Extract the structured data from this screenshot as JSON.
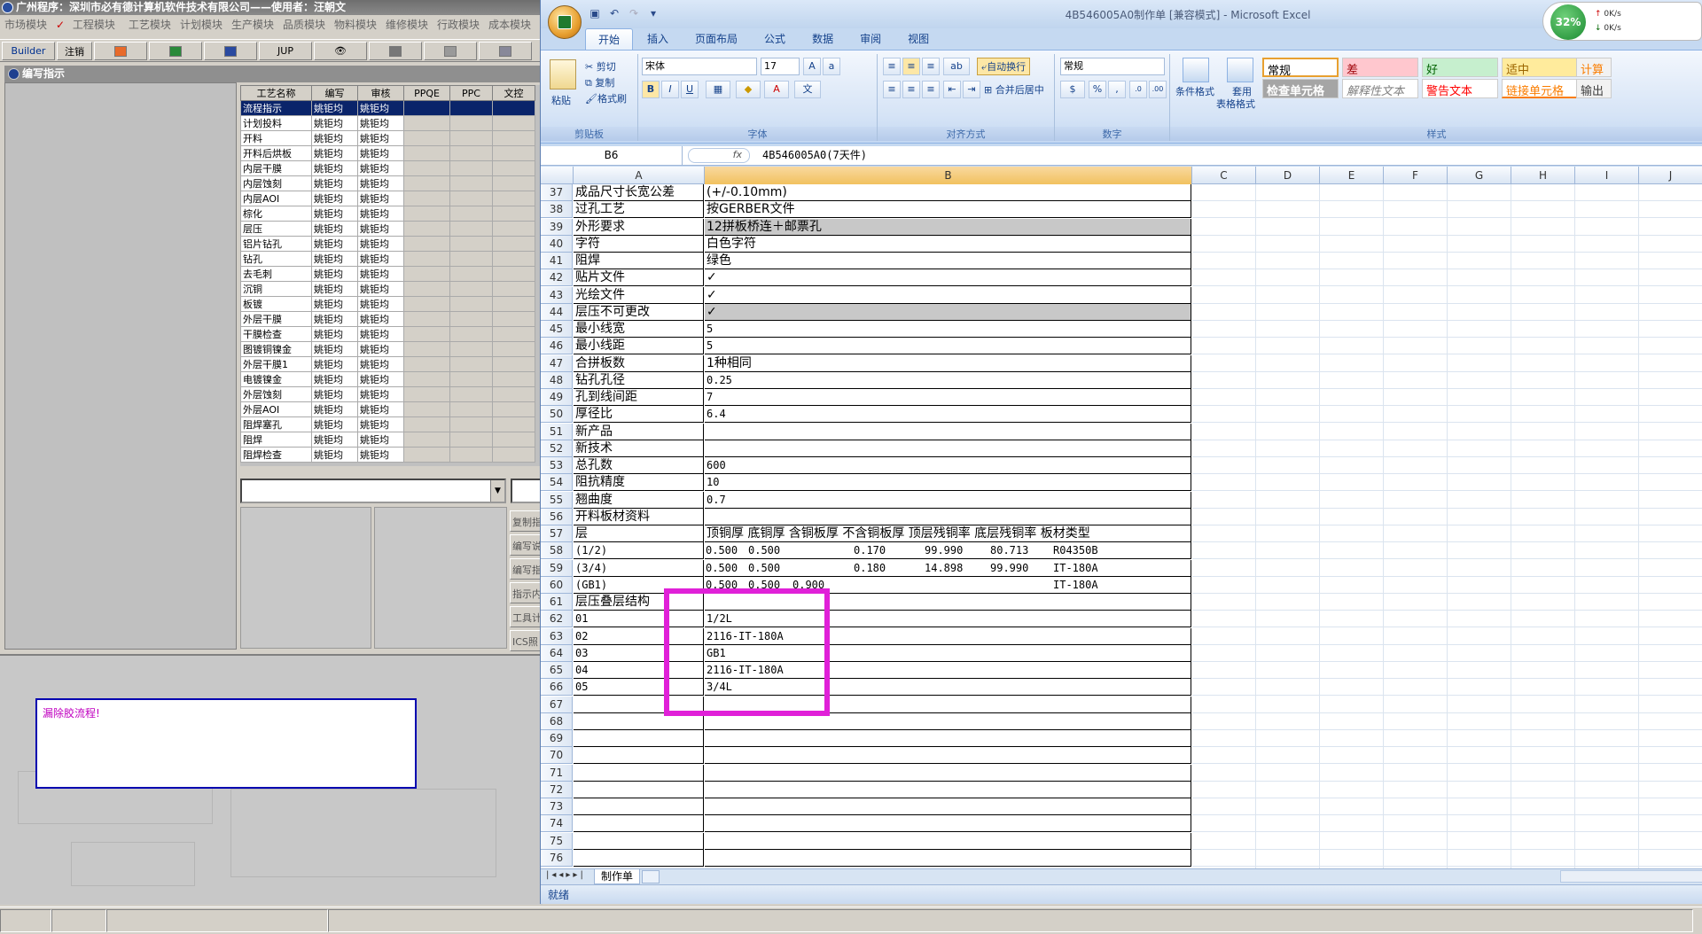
{
  "legacy_app": {
    "title": "广州程序：深圳市必有德计算机软件技术有限公司——使用者：汪朝文",
    "menu": [
      "市场模块",
      "工程模块",
      "工艺模块",
      "计划模块",
      "生产模块",
      "品质模块",
      "物料模块",
      "维修模块",
      "行政模块",
      "成本模块"
    ],
    "toolbar": {
      "builder": "Builder",
      "logout": "注销",
      "jup": "JUP"
    },
    "panel_title": "编写指示",
    "grid_headers": [
      "工艺名称",
      "编写",
      "审核",
      "PPQE",
      "PPC",
      "文控"
    ],
    "grid_rows": [
      [
        "流程指示",
        "姚钜均",
        "姚钜均"
      ],
      [
        "计划投料",
        "姚钜均",
        "姚钜均"
      ],
      [
        "开料",
        "姚钜均",
        "姚钜均"
      ],
      [
        "开料后烘板",
        "姚钜均",
        "姚钜均"
      ],
      [
        "内层干膜",
        "姚钜均",
        "姚钜均"
      ],
      [
        "内层蚀刻",
        "姚钜均",
        "姚钜均"
      ],
      [
        "内层AOI",
        "姚钜均",
        "姚钜均"
      ],
      [
        "棕化",
        "姚钜均",
        "姚钜均"
      ],
      [
        "层压",
        "姚钜均",
        "姚钜均"
      ],
      [
        "铝片钻孔",
        "姚钜均",
        "姚钜均"
      ],
      [
        "钻孔",
        "姚钜均",
        "姚钜均"
      ],
      [
        "去毛刺",
        "姚钜均",
        "姚钜均"
      ],
      [
        "沉铜",
        "姚钜均",
        "姚钜均"
      ],
      [
        "板镀",
        "姚钜均",
        "姚钜均"
      ],
      [
        "外层干膜",
        "姚钜均",
        "姚钜均"
      ],
      [
        "干膜检查",
        "姚钜均",
        "姚钜均"
      ],
      [
        "图镀铜镍金",
        "姚钜均",
        "姚钜均"
      ],
      [
        "外层干膜1",
        "姚钜均",
        "姚钜均"
      ],
      [
        "电镀镍金",
        "姚钜均",
        "姚钜均"
      ],
      [
        "外层蚀刻",
        "姚钜均",
        "姚钜均"
      ],
      [
        "外层AOI",
        "姚钜均",
        "姚钜均"
      ],
      [
        "阻焊塞孔",
        "姚钜均",
        "姚钜均"
      ],
      [
        "阻焊",
        "姚钜均",
        "姚钜均"
      ],
      [
        "阻焊检查",
        "姚钜均",
        "姚钜均"
      ]
    ],
    "side_buttons": [
      "复制指",
      "编写说",
      "编写指",
      "指示内",
      "工具计",
      "ICS照"
    ],
    "message": "漏除胶流程!"
  },
  "excel": {
    "title": "4B546005A0制作单  [兼容模式] - Microsoft Excel",
    "net": {
      "percent": "32%",
      "up": "0K/s",
      "down": "0K/s"
    },
    "tabs": [
      "开始",
      "插入",
      "页面布局",
      "公式",
      "数据",
      "审阅",
      "视图"
    ],
    "ribbon": {
      "paste": "粘贴",
      "cut": "剪切",
      "copy": "复制",
      "format_painter": "格式刷",
      "font": "宋体",
      "font_size": "17",
      "wrap": "自动换行",
      "merge": "合并后居中",
      "number_format": "常规",
      "cond_format": "条件格式",
      "table_format_1": "套用",
      "table_format_2": "表格格式",
      "groups": [
        "剪贴板",
        "字体",
        "对齐方式",
        "数字",
        "样式"
      ],
      "styles": [
        {
          "label": "常规",
          "bg": "#ffffff",
          "fg": "#000000"
        },
        {
          "label": "差",
          "bg": "#ffc7ce",
          "fg": "#9c0006"
        },
        {
          "label": "好",
          "bg": "#c6efce",
          "fg": "#006100"
        },
        {
          "label": "适中",
          "bg": "#ffeb9c",
          "fg": "#9c6500"
        },
        {
          "label": "计算",
          "bg": "#f2f2f2",
          "fg": "#fa7d00"
        },
        {
          "label": "检查单元格",
          "bg": "#a5a5a5",
          "fg": "#ffffff"
        },
        {
          "label": "解释性文本",
          "bg": "#ffffff",
          "fg": "#7f7f7f"
        },
        {
          "label": "警告文本",
          "bg": "#ffffff",
          "fg": "#ff0000"
        },
        {
          "label": "链接单元格",
          "bg": "#ffffff",
          "fg": "#fa7d00"
        },
        {
          "label": "输出",
          "bg": "#f2f2f2",
          "fg": "#3f3f3f"
        }
      ]
    },
    "name_box": "B6",
    "fx": "fx",
    "formula": "4B546005A0(7天件)",
    "columns": [
      "A",
      "B",
      "C",
      "D",
      "E",
      "F",
      "G",
      "H",
      "I",
      "J"
    ],
    "rows": [
      {
        "n": "37",
        "a": "成品尺寸长宽公差",
        "b": "(+/-0.10mm)"
      },
      {
        "n": "38",
        "a": "过孔工艺",
        "b": "按GERBER文件"
      },
      {
        "n": "39",
        "a": "外形要求",
        "b": "12拼板桥连＋邮票孔",
        "gray": true
      },
      {
        "n": "40",
        "a": "字符",
        "b": "白色字符"
      },
      {
        "n": "41",
        "a": "阻焊",
        "b": "绿色"
      },
      {
        "n": "42",
        "a": "贴片文件",
        "b": "✓"
      },
      {
        "n": "43",
        "a": "光绘文件",
        "b": "✓"
      },
      {
        "n": "44",
        "a": "层压不可更改",
        "b": "✓",
        "gray": true
      },
      {
        "n": "45",
        "a": "最小线宽",
        "b": "5"
      },
      {
        "n": "46",
        "a": "最小线距",
        "b": "5"
      },
      {
        "n": "47",
        "a": "合拼板数",
        "b": "1种相同"
      },
      {
        "n": "48",
        "a": "钻孔孔径",
        "b": "0.25"
      },
      {
        "n": "49",
        "a": "孔到线间距",
        "b": "7"
      },
      {
        "n": "50",
        "a": "厚径比",
        "b": "6.4"
      },
      {
        "n": "51",
        "a": "新产品",
        "b": ""
      },
      {
        "n": "52",
        "a": "新技术",
        "b": ""
      },
      {
        "n": "53",
        "a": "总孔数",
        "b": "600"
      },
      {
        "n": "54",
        "a": "阻抗精度",
        "b": "10"
      },
      {
        "n": "55",
        "a": "翘曲度",
        "b": "0.7"
      },
      {
        "n": "56",
        "a": "开料板材资料",
        "b": ""
      },
      {
        "n": "57",
        "a": "层",
        "b": "顶铜厚  底铜厚  含铜板厚  不含铜板厚  顶层残铜率  底层残铜率  板材类型"
      },
      {
        "n": "58",
        "a": "(1/2)",
        "b": ""
      },
      {
        "n": "59",
        "a": "(3/4)",
        "b": ""
      },
      {
        "n": "60",
        "a": "(GB1)",
        "b": ""
      },
      {
        "n": "61",
        "a": "层压叠层结构",
        "b": ""
      },
      {
        "n": "62",
        "a": "01",
        "b": "1/2L"
      },
      {
        "n": "63",
        "a": "02",
        "b": "2116-IT-180A"
      },
      {
        "n": "64",
        "a": "03",
        "b": "GB1"
      },
      {
        "n": "65",
        "a": "04",
        "b": "2116-IT-180A"
      },
      {
        "n": "66",
        "a": "05",
        "b": "3/4L"
      },
      {
        "n": "67",
        "a": "",
        "b": ""
      },
      {
        "n": "68",
        "a": "",
        "b": ""
      },
      {
        "n": "69",
        "a": "",
        "b": ""
      },
      {
        "n": "70",
        "a": "",
        "b": ""
      },
      {
        "n": "71",
        "a": "",
        "b": ""
      },
      {
        "n": "72",
        "a": "",
        "b": ""
      },
      {
        "n": "73",
        "a": "",
        "b": ""
      },
      {
        "n": "74",
        "a": "",
        "b": ""
      },
      {
        "n": "75",
        "a": "",
        "b": ""
      },
      {
        "n": "76",
        "a": "",
        "b": ""
      }
    ],
    "table_rows": [
      [
        "0.500",
        "0.500",
        "",
        "0.170",
        "99.990",
        "80.713",
        "R04350B"
      ],
      [
        "0.500",
        "0.500",
        "",
        "0.180",
        "14.898",
        "99.990",
        "IT-180A"
      ],
      [
        "0.500",
        "0.500",
        "0.900",
        "",
        "",
        "",
        "IT-180A"
      ]
    ],
    "sheet_tab": "制作单",
    "status": "就绪",
    "highlight_color": "#e020d8"
  }
}
